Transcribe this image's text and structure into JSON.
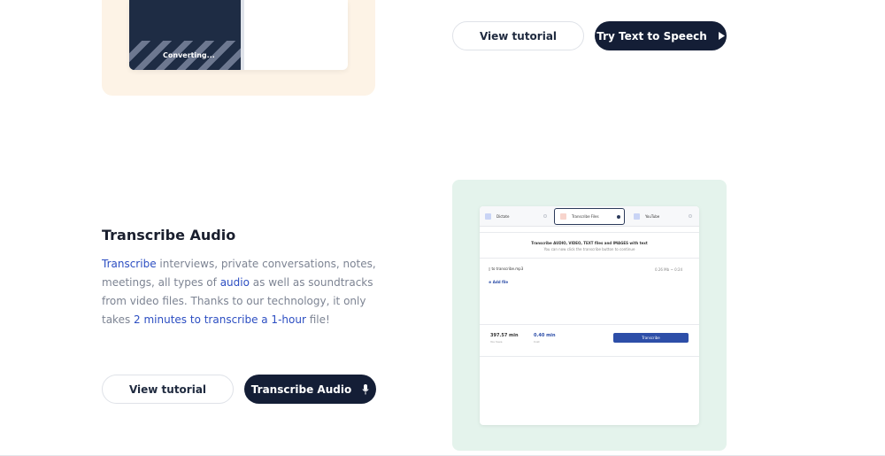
{
  "top_section": {
    "preview_status": "Converting...",
    "view_tutorial_label": "View tutorial",
    "cta_label": "Try Text to Speech",
    "cta_icon": "play-icon"
  },
  "transcribe_section": {
    "title": "Transcribe Audio",
    "paragraph": {
      "w1": "Transcribe",
      "t1": " interviews, private conversations, notes, meetings, all types of ",
      "w2": "audio",
      "t2": " as well as soundtracks from video files. Thanks to our technology, it only takes ",
      "w3": "2 minutes to transcribe a 1-hour",
      "t3": " file!"
    },
    "view_tutorial_label": "View tutorial",
    "cta_label": "Transcribe Audio",
    "cta_icon": "microphone-icon",
    "accent_color": "#2c4ec2"
  },
  "preview": {
    "tabs": [
      {
        "label": "Dictate",
        "icon": "microphone-icon"
      },
      {
        "label": "Transcribe Files",
        "icon": "file-icon"
      },
      {
        "label": "YouTube",
        "icon": "youtube-icon"
      }
    ],
    "heading": "Transcribe AUDIO, VIDEO, TEXT files and IMAGES with text",
    "subheading": "You can now click the transcribe button to continue",
    "file_name": "to transcribe.mp3",
    "file_meta": "0.26 Mb ~ 0:24",
    "add_file_label": "Add file",
    "minutes_left_value": "397.57 min",
    "minutes_left_label": "You have",
    "cost_value": "0.40 min",
    "cost_label": "Cost",
    "transcribe_button": "Transcribe"
  }
}
